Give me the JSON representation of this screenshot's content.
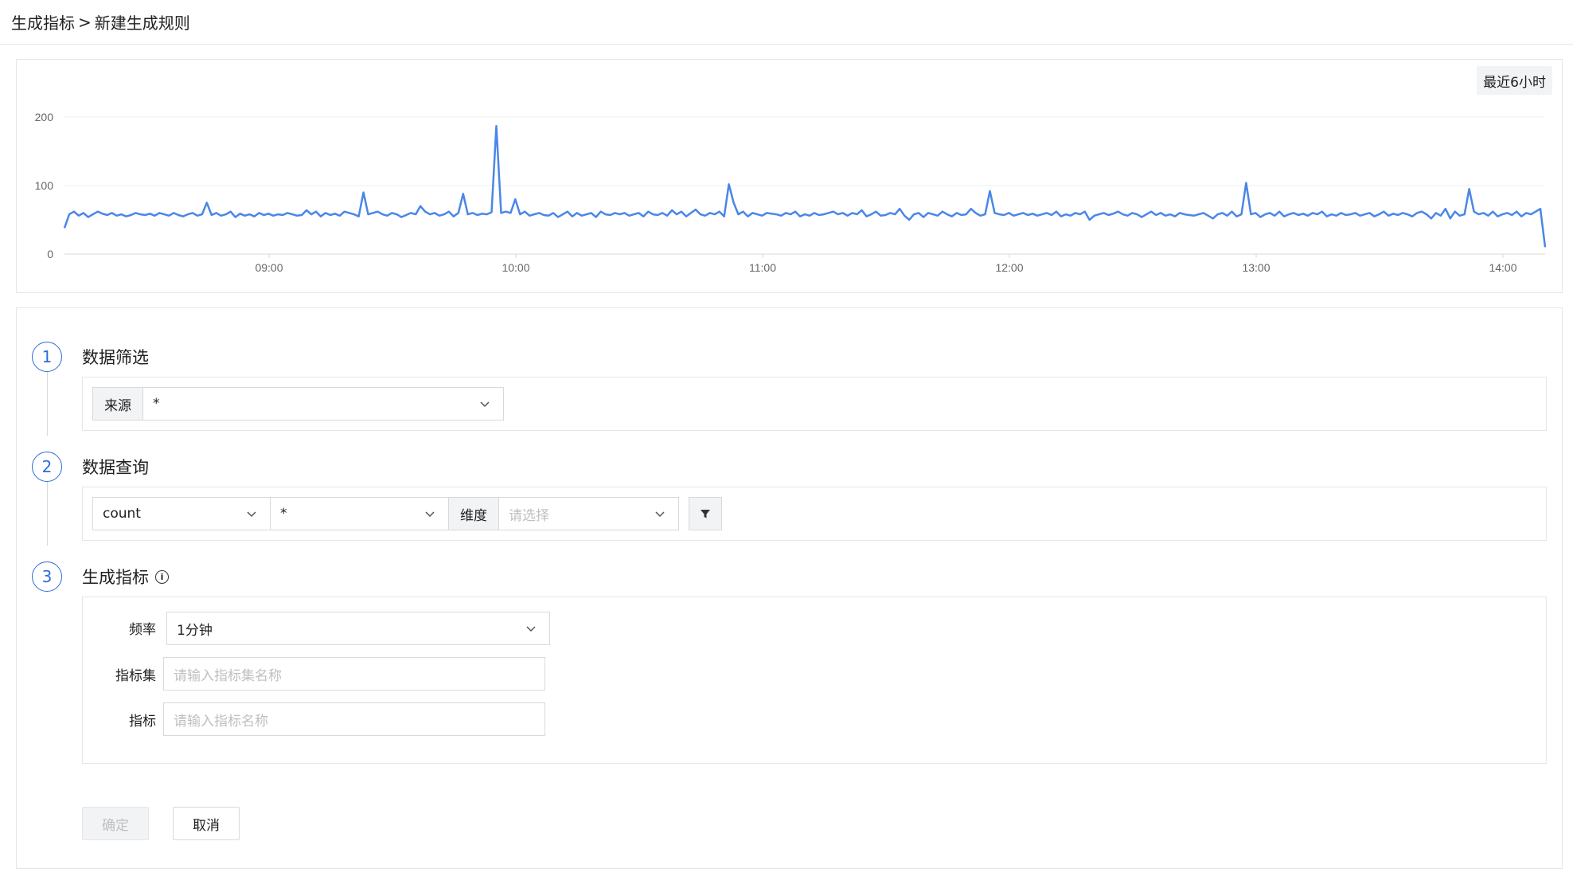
{
  "breadcrumb": {
    "parent": "生成指标",
    "separator": ">",
    "current": "新建生成规则"
  },
  "chart_panel": {
    "time_range_label": "最近6小时"
  },
  "chart_data": {
    "type": "line",
    "ylim": [
      0,
      200
    ],
    "y_ticks": [
      "200",
      "100",
      "0"
    ],
    "x_ticks": [
      "09:00",
      "10:00",
      "11:00",
      "12:00",
      "13:00",
      "14:00"
    ],
    "line_color": "#4a86e8",
    "series": [
      {
        "values": [
          38,
          58,
          62,
          56,
          60,
          54,
          58,
          62,
          59,
          57,
          60,
          56,
          58,
          55,
          57,
          60,
          58,
          57,
          59,
          56,
          60,
          58,
          56,
          60,
          57,
          55,
          58,
          60,
          56,
          58,
          75,
          57,
          60,
          56,
          58,
          62,
          54,
          59,
          56,
          58,
          55,
          60,
          57,
          59,
          56,
          58,
          57,
          60,
          58,
          56,
          57,
          64,
          58,
          62,
          55,
          60,
          57,
          59,
          56,
          62,
          60,
          58,
          55,
          90,
          58,
          60,
          62,
          58,
          56,
          60,
          58,
          54,
          57,
          60,
          58,
          70,
          62,
          58,
          60,
          56,
          58,
          62,
          55,
          60,
          88,
          58,
          60,
          57,
          59,
          58,
          61,
          187,
          60,
          62,
          60,
          80,
          58,
          62,
          56,
          58,
          60,
          57,
          56,
          60,
          54,
          58,
          62,
          55,
          60,
          56,
          58,
          60,
          54,
          62,
          58,
          57,
          60,
          58,
          60,
          56,
          58,
          60,
          55,
          62,
          58,
          57,
          60,
          56,
          64,
          58,
          62,
          55,
          60,
          65,
          58,
          56,
          60,
          58,
          62,
          55,
          102,
          75,
          58,
          62,
          55,
          60,
          58,
          56,
          60,
          59,
          58,
          56,
          60,
          58,
          62,
          55,
          58,
          56,
          60,
          57,
          58,
          60,
          62,
          58,
          60,
          56,
          60,
          58,
          64,
          55,
          58,
          62,
          56,
          57,
          60,
          58,
          66,
          56,
          50,
          58,
          60,
          54,
          60,
          58,
          56,
          62,
          58,
          55,
          60,
          57,
          58,
          66,
          60,
          56,
          58,
          92,
          60,
          58,
          57,
          60,
          56,
          58,
          60,
          57,
          59,
          56,
          58,
          60,
          57,
          62,
          55,
          58,
          56,
          60,
          58,
          62,
          50,
          56,
          58,
          60,
          57,
          59,
          62,
          58,
          56,
          60,
          58,
          54,
          58,
          62,
          57,
          60,
          56,
          58,
          55,
          60,
          58,
          57,
          56,
          58,
          60,
          56,
          52,
          58,
          60,
          56,
          62,
          55,
          58,
          104,
          58,
          60,
          54,
          58,
          60,
          56,
          62,
          55,
          58,
          60,
          57,
          59,
          56,
          60,
          58,
          62,
          55,
          58,
          56,
          60,
          57,
          58,
          60,
          56,
          58,
          60,
          55,
          58,
          62,
          56,
          59,
          57,
          60,
          58,
          55,
          60,
          62,
          58,
          52,
          60,
          56,
          66,
          52,
          62,
          56,
          58,
          95,
          62,
          58,
          60,
          56,
          62,
          55,
          58,
          60,
          57,
          62,
          55,
          60,
          58,
          62,
          66,
          10
        ]
      }
    ]
  },
  "steps": [
    {
      "num": "1",
      "title": "数据筛选"
    },
    {
      "num": "2",
      "title": "数据查询"
    },
    {
      "num": "3",
      "title": "生成指标"
    }
  ],
  "filter": {
    "source_prefix": "来源",
    "source_value": "*"
  },
  "query": {
    "agg_value": "count",
    "field_value": "*",
    "dimension_prefix": "维度",
    "dimension_placeholder": "请选择"
  },
  "metric": {
    "frequency_label": "频率",
    "frequency_value": "1分钟",
    "metric_set_label": "指标集",
    "metric_set_placeholder": "请输入指标集名称",
    "metric_label": "指标",
    "metric_placeholder": "请输入指标名称"
  },
  "actions": {
    "ok_label": "确定",
    "cancel_label": "取消"
  }
}
